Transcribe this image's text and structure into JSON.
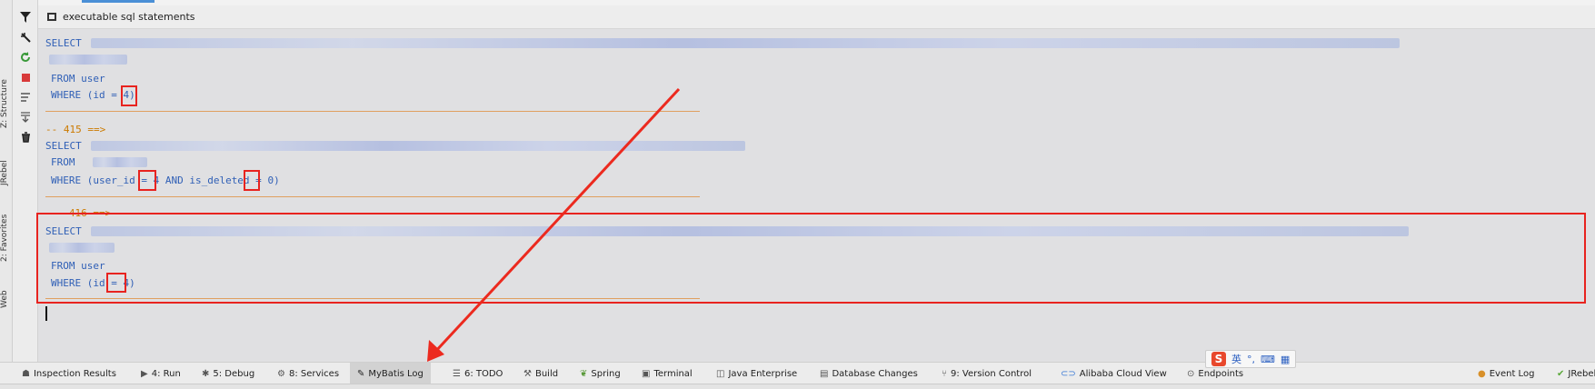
{
  "header": {
    "title": "executable sql statements"
  },
  "sidebar_left": {
    "tabs": [
      "Z: Structure",
      "JRebel",
      "2: Favorites",
      "Web"
    ]
  },
  "log": {
    "block1": {
      "select": "SELECT",
      "from": "FROM user",
      "where_prefix": "WHERE (id = ",
      "where_value": "4",
      "where_suffix": ")"
    },
    "block2": {
      "separator": "-- 415 ==>",
      "select": "SELECT",
      "from": "FROM",
      "where_prefix": "WHERE (user_id = ",
      "where_value1": "4",
      "where_middle": " AND is_deleted = ",
      "where_value2": "0",
      "where_suffix": ")"
    },
    "block3": {
      "separator": "-- 416 ==>",
      "select": "SELECT",
      "from": "FROM user",
      "where_prefix": "WHERE (id = ",
      "where_value": "4",
      "where_suffix": ")"
    }
  },
  "bottom_tabs": [
    {
      "label": "Inspection Results",
      "icon": "inspection-icon"
    },
    {
      "label": "4: Run",
      "icon": "run-icon"
    },
    {
      "label": "5: Debug",
      "icon": "debug-icon"
    },
    {
      "label": "8: Services",
      "icon": "services-icon"
    },
    {
      "label": "MyBatis Log",
      "icon": "mybatis-icon"
    },
    {
      "label": "6: TODO",
      "icon": "todo-icon"
    },
    {
      "label": "Build",
      "icon": "build-icon"
    },
    {
      "label": "Spring",
      "icon": "spring-icon"
    },
    {
      "label": "Terminal",
      "icon": "terminal-icon"
    },
    {
      "label": "Java Enterprise",
      "icon": "java-enterprise-icon"
    },
    {
      "label": "Database Changes",
      "icon": "database-changes-icon"
    },
    {
      "label": "9: Version Control",
      "icon": "version-control-icon"
    },
    {
      "label": "Alibaba Cloud View",
      "icon": "alibaba-cloud-icon"
    },
    {
      "label": "Endpoints",
      "icon": "endpoints-icon"
    },
    {
      "label": "Event Log",
      "icon": "event-log-icon"
    },
    {
      "label": "JRebel",
      "icon": "jrebel-icon"
    }
  ],
  "ime": {
    "lang": "英",
    "logo": "S"
  },
  "colors": {
    "highlight": "#e8231f",
    "keyword": "#2f5fb6",
    "separator": "#cc7a00"
  }
}
